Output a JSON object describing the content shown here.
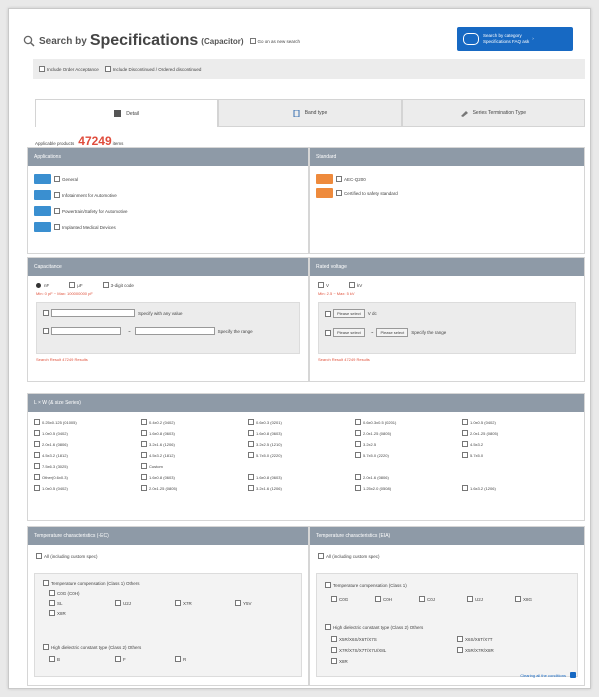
{
  "header": {
    "title_prefix": "Search by",
    "title_main": "Specifications",
    "title_sub": "(Capacitor)",
    "quick_search_label": "Go on as new search",
    "help_button_line1": "Search by category",
    "help_button_line2": "Specifications FAQ ask",
    "help_button_arrow": "›"
  },
  "scope": {
    "option1": "Include Order Acceptance",
    "option2": "Include Discontinued / Ordered discontinued"
  },
  "tabs": [
    {
      "label": "Detail",
      "icon": "list-icon"
    },
    {
      "label": "Band type",
      "icon": "person-icon"
    },
    {
      "label": "Series Termination Type",
      "icon": "tool-icon"
    }
  ],
  "applicable": {
    "prefix": "Applicable products",
    "count": "47249",
    "suffix": "items"
  },
  "applications": {
    "title": "Applications",
    "items": [
      {
        "label": "General"
      },
      {
        "label": "Infotainment for Automotive"
      },
      {
        "label": "Powertrain/Safety for Automotive"
      },
      {
        "label": "Implanted Medical Devices"
      }
    ]
  },
  "standard": {
    "title": "Standard",
    "items": [
      {
        "label": "AEC-Q200"
      },
      {
        "label": "Certified to safety standard"
      }
    ]
  },
  "capacitance": {
    "title": "Capacitance",
    "units": [
      "nF",
      "μF",
      "3-digit code"
    ],
    "minmax_note": "Min: 0 pF ~ Max: 100000000 pF",
    "specify_label": "Specify with any value",
    "range_sep": "~",
    "range_label": "Specify the range",
    "search_result": "Search Result 47249 Results"
  },
  "rated_voltage": {
    "title": "Rated voltage",
    "units": [
      "V",
      "kV"
    ],
    "minmax_note": "Min: 2.5 ~ Max: 5 kV",
    "select_placeholder": "Please select",
    "unit_v": "V dc",
    "range_sep": "~",
    "range_label": "Specify the range",
    "search_result": "Search Result 47249 Results"
  },
  "size": {
    "title": "L × W (& size Series)",
    "items": [
      "0.25x0.125 (01005)",
      "0.4x0.2 (0402)",
      "0.6x0.3 (0201)",
      "0.6x0.3x0.5 (0201)",
      "1.0x0.5 (0402)",
      "1.0x0.5 (0402)",
      "1.6x0.8 (0603)",
      "1.6x0.8 (0603)",
      "2.0x1.25 (0805)",
      "2.0x1.25 (0805)",
      "2.0x1.6 (0806)",
      "3.2x1.6 (1206)",
      "3.2x2.5 (1210)",
      "3.2x2.5",
      "4.5x3.2",
      "4.5x3.2 (1812)",
      "4.5x3.2 (1812)",
      "5.7x5.0 (2220)",
      "5.7x5.0 (2220)",
      "5.7x5.0",
      "7.5x6.3 (3025)",
      "Custom",
      "",
      "",
      "",
      "Other(0.6x0.3)",
      "1.6x0.8 (0603)",
      "1.6x0.8 (0603)",
      "2.0x1.6 (0806)",
      "",
      "1.0x0.5 (0402)",
      "2.0x1.25 (0805)",
      "3.2x1.6 (1206)",
      "1.25x2.0 (0508)",
      "1.6x3.2 (1206)"
    ]
  },
  "temp_left": {
    "title": "Temperature characteristics (-EC)",
    "all_label": "All (including custom spec)",
    "group1_label": "Temperature compensation (Class 1) Others",
    "group1_items": [
      "C0G (C0H)",
      "SL",
      "U2J",
      "X7R",
      "Y5V",
      "X8R"
    ],
    "group2_label": "High dielectric constant type (Class 2) Others",
    "group2_items": [
      "B",
      "F",
      "R"
    ]
  },
  "temp_right": {
    "title": "Temperature characteristics (EIA)",
    "all_label": "All (including custom spec)",
    "group1_label": "Temperature compensation (Class 1)",
    "group1_items": [
      "C0G",
      "C0H",
      "C0J",
      "U2J",
      "X8G"
    ],
    "group2_label": "High dielectric constant type (Class 2) Others",
    "group2_items": [
      "X5R/X6S/X6T/X7S",
      "X6S/X6T/X7T",
      "X7R/X7S/X7T/X7U/X8L",
      "X5R/X7R/X8R",
      "X8R"
    ]
  },
  "footer": {
    "clear_label": "Clearing all the conditions"
  }
}
